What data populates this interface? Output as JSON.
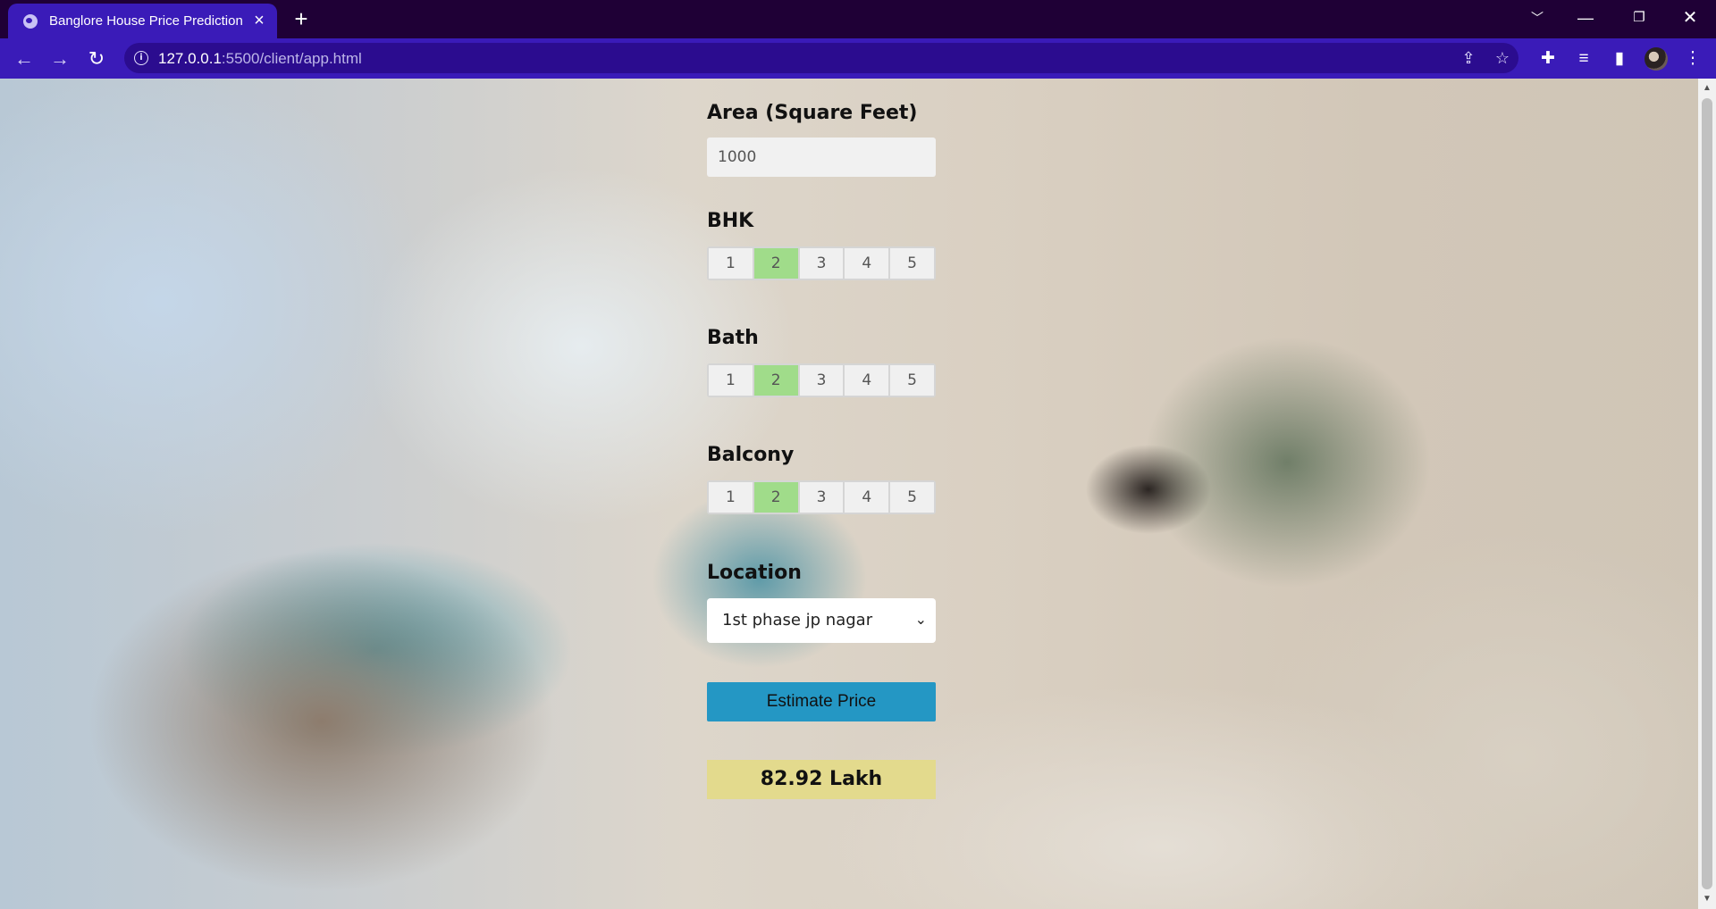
{
  "browser": {
    "tab_title": "Banglore House Price Prediction",
    "url_host": "127.0.0.1",
    "url_rest": ":5500/client/app.html"
  },
  "icons": {
    "tab_favicon": "globe-icon",
    "tab_close": "close-icon",
    "new_tab": "plus-icon",
    "back": "arrow-left-icon",
    "forward": "arrow-right-icon",
    "reload": "reload-icon",
    "site_info": "info-icon",
    "share": "share-icon",
    "bookmark": "star-icon",
    "extensions": "puzzle-icon",
    "media": "media-queue-icon",
    "side_panel": "side-panel-icon",
    "menu": "kebab-menu-icon"
  },
  "form": {
    "area": {
      "label": "Area (Square Feet)",
      "value": "1000"
    },
    "bhk": {
      "label": "BHK",
      "options": [
        "1",
        "2",
        "3",
        "4",
        "5"
      ],
      "selected": "2"
    },
    "bath": {
      "label": "Bath",
      "options": [
        "1",
        "2",
        "3",
        "4",
        "5"
      ],
      "selected": "2"
    },
    "balcony": {
      "label": "Balcony",
      "options": [
        "1",
        "2",
        "3",
        "4",
        "5"
      ],
      "selected": "2"
    },
    "location": {
      "label": "Location",
      "selected": "1st phase jp nagar"
    },
    "estimate_button": "Estimate Price",
    "result": "82.92 Lakh"
  },
  "colors": {
    "chrome_bg": "#1f0036",
    "toolbar_bg": "#3a1bb8",
    "selected_option": "#a0dc8a",
    "button_bg": "#2497c4",
    "result_bg": "#e3da8d"
  }
}
